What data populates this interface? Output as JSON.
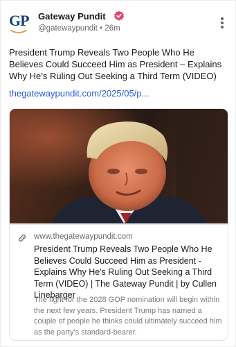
{
  "account": {
    "avatar_text": "GP",
    "name": "Gateway Pundit",
    "handle": "@gatewaypundit",
    "separator": "•",
    "time": "26m",
    "badge_color": "#e8436e"
  },
  "post": {
    "text": "President Trump Reveals Two People Who He Believes Could Succeed Him as President – Explains Why He’s Ruling Out Seeking a Third Term (VIDEO)",
    "link": "thegatewaypundit.com/2025/05/p..."
  },
  "preview": {
    "domain": "www.thegatewaypundit.com",
    "title": "President Trump Reveals Two People Who He Believes Could Succeed Him as President - Explains Why He's Ruling Out Seeking a Third Term (VIDEO) | The Gateway Pundit | by Cullen Linebarger",
    "description": "The fight for the 2028 GOP nomination will begin within the next few years. President Trump has named a couple of people he thinks could ultimately succeed him as the party's standard-bearer.",
    "icon": "link-icon"
  },
  "colors": {
    "link": "#2a5bd7",
    "brand_navy": "#1a3f7a"
  }
}
